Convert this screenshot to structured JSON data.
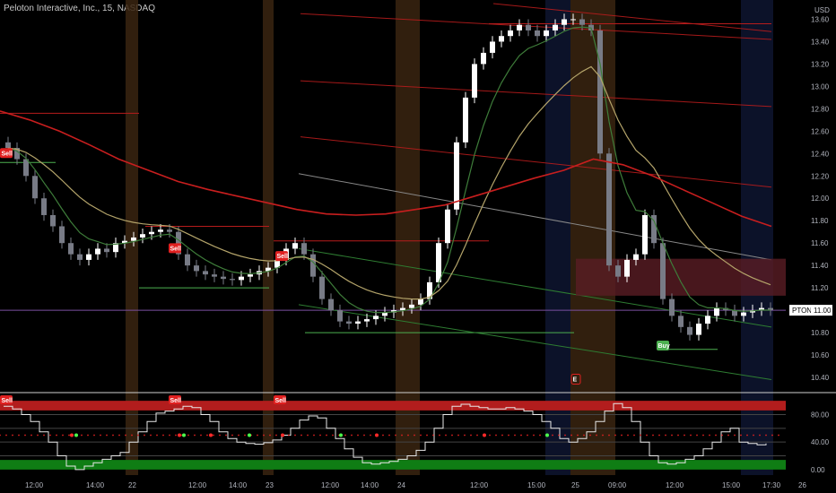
{
  "header": {
    "symbol_title": "Peloton Interactive, Inc., 15, NASDAQ",
    "currency": "USD"
  },
  "price_tag": {
    "symbol": "PTON",
    "value": "11.00"
  },
  "colors": {
    "background": "#000000",
    "bull": "#ffffff",
    "bear": "#787b86",
    "ema_fast": "#3e7d3a",
    "ema_slow": "#b4a46a",
    "ma_long": "#c81e1e",
    "red_line": "#b71c1c",
    "green_line": "#4caf50",
    "zone": "#5a1d24",
    "session_orange": "#3a2410",
    "session_blue": "#0e1530",
    "osc_top": "#b21d1d",
    "osc_bottom": "#0f7d14"
  },
  "chart_data": [
    {
      "type": "candlestick",
      "title": "Peloton Interactive, Inc., 15, NASDAQ",
      "ylabel": "USD",
      "ylim": [
        10.28,
        13.74
      ],
      "y_ticks": [
        10.4,
        10.6,
        10.8,
        11.0,
        11.2,
        11.4,
        11.6,
        11.8,
        12.0,
        12.2,
        12.4,
        12.6,
        12.8,
        13.0,
        13.2,
        13.4,
        13.6
      ],
      "x_tick_labels": [
        "12:00",
        "14:00",
        "22",
        "12:00",
        "14:00",
        "23",
        "12:00",
        "14:00",
        "24",
        "12:00",
        "15:00",
        "25",
        "09:00",
        "12:00",
        "15:00",
        "17:30",
        "26"
      ],
      "close": [
        12.45,
        12.35,
        12.2,
        12.0,
        11.85,
        11.75,
        11.6,
        11.5,
        11.45,
        11.5,
        11.55,
        11.52,
        11.6,
        11.62,
        11.65,
        11.68,
        11.7,
        11.72,
        11.7,
        11.5,
        11.4,
        11.35,
        11.32,
        11.3,
        11.28,
        11.27,
        11.3,
        11.32,
        11.35,
        11.38,
        11.45,
        11.55,
        11.6,
        11.5,
        11.3,
        11.1,
        11.0,
        10.9,
        10.88,
        10.9,
        10.92,
        10.95,
        10.98,
        11.0,
        11.02,
        11.05,
        11.1,
        11.25,
        11.6,
        11.9,
        12.5,
        12.9,
        13.2,
        13.3,
        13.4,
        13.45,
        13.5,
        13.55,
        13.5,
        13.45,
        13.5,
        13.55,
        13.6,
        13.6,
        13.55,
        13.5,
        12.4,
        11.4,
        11.3,
        11.45,
        11.5,
        11.85,
        11.6,
        11.1,
        10.95,
        10.85,
        10.78,
        10.88,
        10.95,
        11.02,
        11.0,
        10.95,
        10.98,
        11.0,
        11.02,
        11.0
      ],
      "series": [
        {
          "name": "ema-fast",
          "ref": "close",
          "period": 6
        },
        {
          "name": "ema-slow",
          "ref": "close",
          "period": 16
        },
        {
          "name": "ma-long",
          "values": [
            12.78,
            12.7,
            12.6,
            12.48,
            12.35,
            12.25,
            12.15,
            12.08,
            12.02,
            11.96,
            11.9,
            11.86,
            11.85,
            11.86,
            11.9,
            11.94,
            12.02,
            12.1,
            12.18,
            12.25,
            12.35,
            12.3,
            12.2,
            12.08,
            11.96,
            11.84,
            11.75
          ],
          "x_from": 0,
          "x_to": 860
        }
      ],
      "signals": [
        {
          "label": "Sell",
          "price": 12.4
        },
        {
          "label": "Sell",
          "price": 11.55
        },
        {
          "label": "Sell",
          "price": 11.48
        },
        {
          "label": "Buy",
          "price": 10.68
        },
        {
          "label": "E",
          "price": 10.38
        }
      ]
    },
    {
      "type": "line",
      "title": "",
      "ylim": [
        -8,
        108
      ],
      "y_ticks": [
        0,
        40,
        80
      ],
      "y_tick_labels": [
        "0.00",
        "40.00",
        "80.00"
      ],
      "values": [
        92,
        88,
        80,
        70,
        55,
        40,
        20,
        5,
        0,
        5,
        10,
        15,
        20,
        25,
        40,
        55,
        70,
        82,
        85,
        88,
        92,
        90,
        80,
        70,
        55,
        45,
        40,
        38,
        37,
        39,
        43,
        50,
        60,
        72,
        78,
        75,
        60,
        45,
        30,
        18,
        10,
        8,
        10,
        12,
        15,
        20,
        28,
        40,
        60,
        80,
        92,
        95,
        92,
        90,
        88,
        88,
        90,
        88,
        85,
        80,
        70,
        60,
        45,
        40,
        45,
        55,
        70,
        85,
        96,
        90,
        70,
        40,
        20,
        10,
        8,
        10,
        15,
        20,
        30,
        40,
        55,
        60,
        40,
        38,
        36,
        38
      ],
      "dots_red": [
        [
          0,
          80
        ],
        [
          2,
          200
        ],
        [
          3,
          235
        ],
        [
          5,
          315
        ],
        [
          6,
          420
        ],
        [
          7,
          540
        ]
      ],
      "dots_green": [
        [
          1,
          85
        ],
        [
          2,
          205
        ],
        [
          4,
          278
        ],
        [
          5,
          380
        ],
        [
          7,
          610
        ]
      ],
      "signals": [
        {
          "label": "Sell",
          "price": 100
        },
        {
          "label": "Sell",
          "price": 100
        },
        {
          "label": "Sell",
          "price": 100
        }
      ]
    }
  ]
}
